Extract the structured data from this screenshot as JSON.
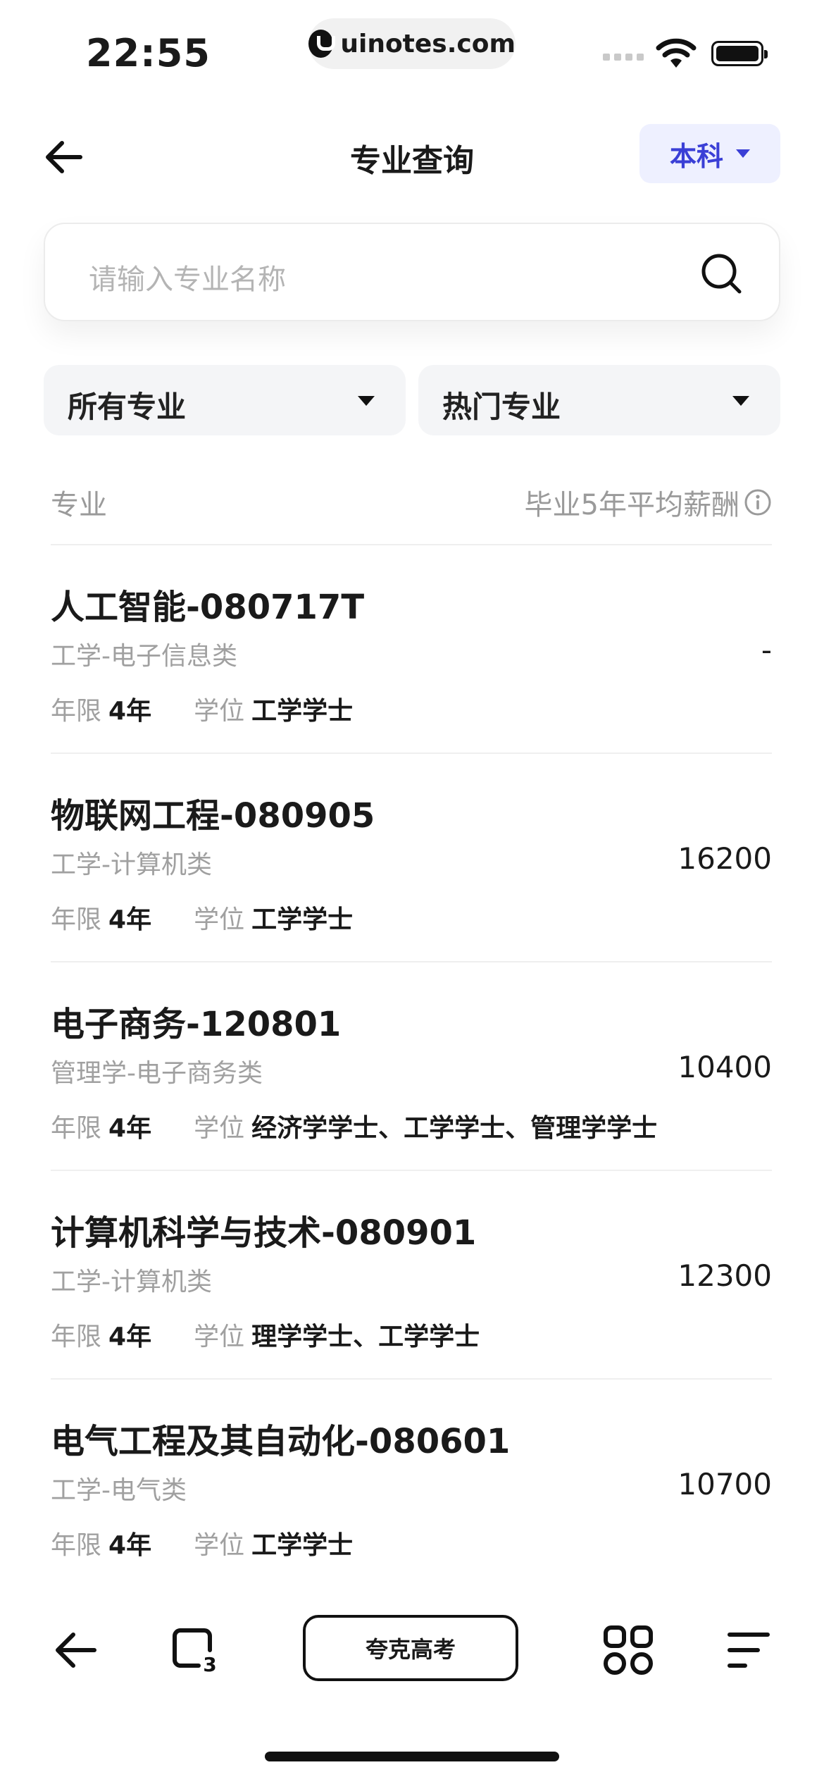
{
  "status_bar": {
    "time": "22:55",
    "url": "uinotes.com"
  },
  "header": {
    "title": "专业查询",
    "level_selector": "本科"
  },
  "search": {
    "placeholder": "请输入专业名称"
  },
  "filters": {
    "category": "所有专业",
    "sort": "热门专业"
  },
  "columns": {
    "left": "专业",
    "right": "毕业5年平均薪酬"
  },
  "majors": [
    {
      "title": "人工智能-080717T",
      "category": "工学-电子信息类",
      "duration_label": "年限",
      "duration": "4年",
      "degree_label": "学位",
      "degree": "工学学士",
      "salary": "-"
    },
    {
      "title": "物联网工程-080905",
      "category": "工学-计算机类",
      "duration_label": "年限",
      "duration": "4年",
      "degree_label": "学位",
      "degree": "工学学士",
      "salary": "16200"
    },
    {
      "title": "电子商务-120801",
      "category": "管理学-电子商务类",
      "duration_label": "年限",
      "duration": "4年",
      "degree_label": "学位",
      "degree": "经济学学士、工学学士、管理学学士",
      "salary": "10400"
    },
    {
      "title": "计算机科学与技术-080901",
      "category": "工学-计算机类",
      "duration_label": "年限",
      "duration": "4年",
      "degree_label": "学位",
      "degree": "理学学士、工学学士",
      "salary": "12300"
    },
    {
      "title": "电气工程及其自动化-080601",
      "category": "工学-电气类",
      "duration_label": "年限",
      "duration": "4年",
      "degree_label": "学位",
      "degree": "工学学士",
      "salary": "10700"
    }
  ],
  "bottom_bar": {
    "center_label": "夸克高考",
    "tab_count": "3"
  },
  "colors": {
    "accent": "#3a3fd6",
    "accent_bg": "#eef0ff",
    "muted": "#a0a0a0"
  }
}
